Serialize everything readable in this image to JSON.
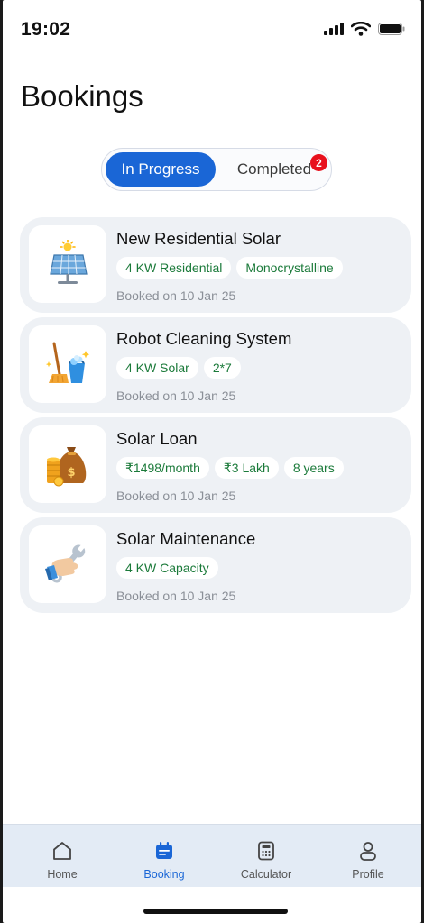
{
  "status": {
    "time": "19:02"
  },
  "page": {
    "title": "Bookings"
  },
  "segments": {
    "active": "In Progress",
    "inactive": "Completed",
    "badge": "2"
  },
  "bookings": [
    {
      "title": "New Residential Solar",
      "tags": [
        "4 KW Residential",
        "Monocrystalline"
      ],
      "date": "Booked on 10 Jan 25",
      "icon": "solar-panel-icon"
    },
    {
      "title": "Robot Cleaning System",
      "tags": [
        "4 KW Solar",
        "2*7"
      ],
      "date": "Booked on 10 Jan 25",
      "icon": "cleaning-bucket-icon"
    },
    {
      "title": "Solar Loan",
      "tags": [
        "₹1498/month",
        "₹3 Lakh",
        "8 years"
      ],
      "date": "Booked on 10 Jan 25",
      "icon": "money-bag-icon"
    },
    {
      "title": "Solar Maintenance",
      "tags": [
        "4 KW Capacity"
      ],
      "date": "Booked on 10 Jan 25",
      "icon": "wrench-hand-icon"
    }
  ],
  "tabs": [
    {
      "label": "Home",
      "icon": "home-icon"
    },
    {
      "label": "Booking",
      "icon": "calendar-icon",
      "active": true
    },
    {
      "label": "Calculator",
      "icon": "calculator-icon"
    },
    {
      "label": "Profile",
      "icon": "user-icon"
    }
  ],
  "colors": {
    "accent": "#1a66d6",
    "chip_text": "#1b7a3a",
    "badge": "#e8101c",
    "card_bg": "#eef1f5",
    "tab_bar_bg": "#e3ebf5"
  }
}
